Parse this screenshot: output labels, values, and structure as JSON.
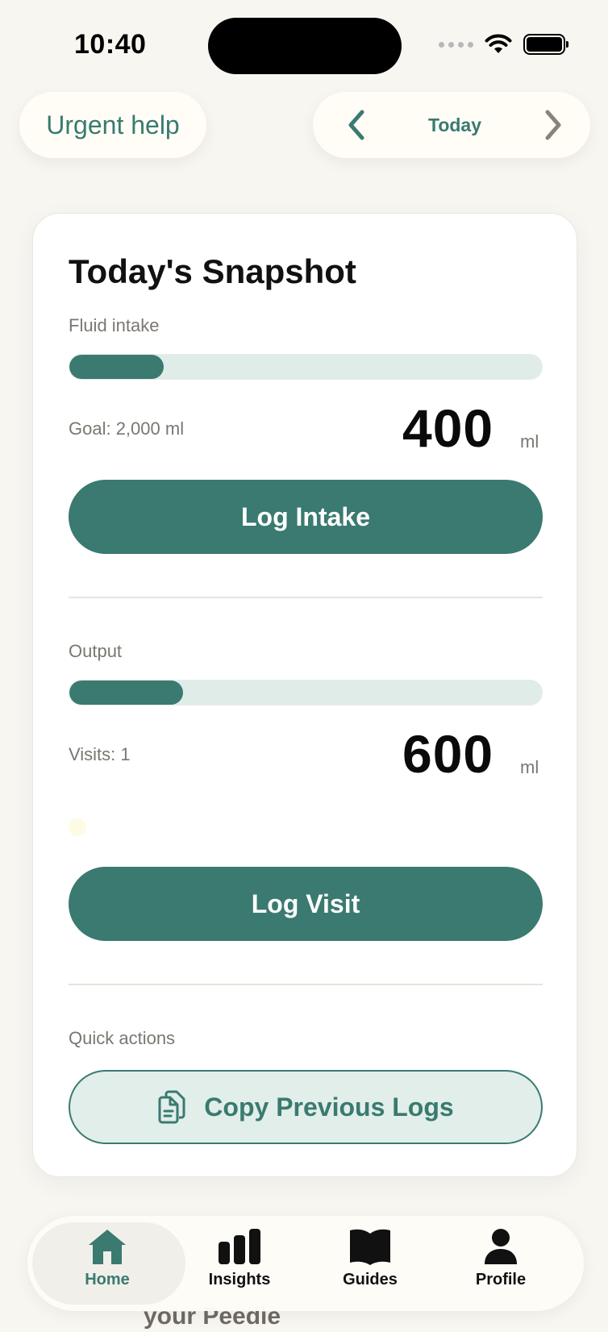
{
  "status_bar": {
    "time": "10:40"
  },
  "header": {
    "urgent_help": "Urgent help",
    "date_label": "Today"
  },
  "snapshot": {
    "title": "Today's Snapshot",
    "fluid_intake": {
      "label": "Fluid intake",
      "progress_fraction": 0.2,
      "goal_text": "Goal: 2,000 ml",
      "value": "400",
      "unit": "ml",
      "button_label": "Log Intake"
    },
    "output": {
      "label": "Output",
      "progress_fraction": 0.24,
      "visits_text": "Visits: 1",
      "value": "600",
      "unit": "ml",
      "button_label": "Log Visit"
    },
    "quick_actions": {
      "label": "Quick actions",
      "copy_button_label": "Copy Previous Logs"
    }
  },
  "tabbar": {
    "tabs": [
      {
        "label": "Home",
        "icon": "home-icon",
        "active": true
      },
      {
        "label": "Insights",
        "icon": "bar-chart-icon",
        "active": false
      },
      {
        "label": "Guides",
        "icon": "book-icon",
        "active": false
      },
      {
        "label": "Profile",
        "icon": "person-icon",
        "active": false
      }
    ]
  },
  "background_text": "your Peedie",
  "colors": {
    "accent": "#3a7a70",
    "background": "#f8f6f1",
    "track": "#dfece8"
  }
}
